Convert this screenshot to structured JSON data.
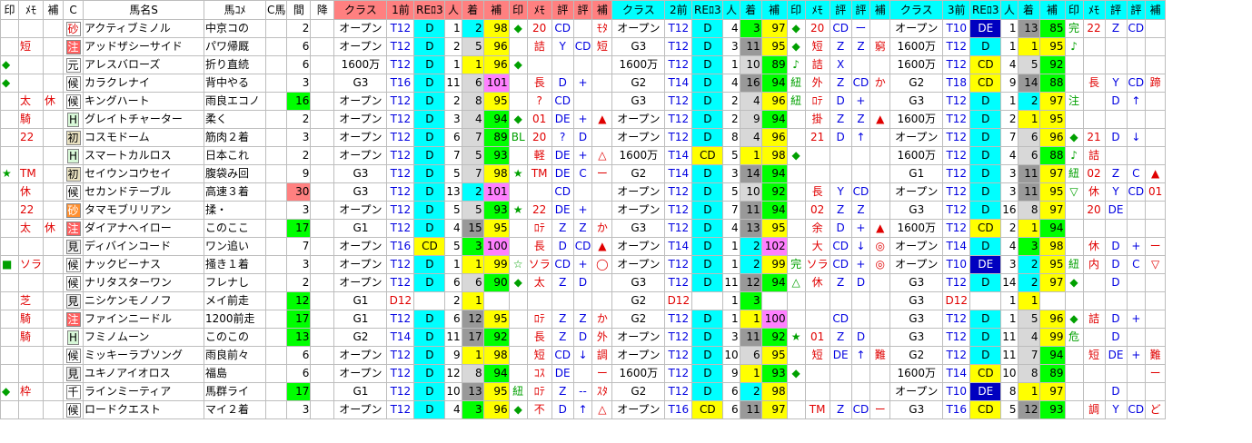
{
  "header": [
    "印",
    "ﾒﾓ",
    "補",
    "C",
    "馬名S",
    "馬ｺﾒ",
    "C馬",
    "間",
    "降",
    "クラス",
    "1前",
    "REﾛ3",
    "人",
    "着",
    "補",
    "印",
    "ﾒﾓ",
    "評",
    "評",
    "補",
    "クラス",
    "2前",
    "REﾛ3",
    "人",
    "着",
    "補",
    "印",
    "ﾒﾓ",
    "評",
    "評",
    "補",
    "クラス",
    "3前",
    "REﾛ3",
    "人",
    "着",
    "補",
    "印",
    "ﾒﾓ",
    "評",
    "評",
    "補"
  ],
  "rows": [
    [
      "",
      "",
      "",
      "砂",
      "アクティブミノル",
      "中京コの",
      "",
      "2",
      "",
      "オープン",
      "T12",
      "D",
      "1",
      "2",
      "98",
      "◆",
      "20",
      "CD",
      "",
      "ﾓﾀ",
      "オープン",
      "T12",
      "D",
      "4",
      "3",
      "97",
      "◆",
      "20",
      "CD",
      "ー",
      "",
      "オープン",
      "T10",
      "DE",
      "1",
      "13",
      "85",
      "完",
      "22",
      "Z",
      "CD",
      ""
    ],
    [
      "",
      "短",
      "",
      "注",
      "アッドザシーサイド",
      "パワ帰厩",
      "",
      "6",
      "",
      "オープン",
      "T12",
      "D",
      "2",
      "5",
      "96",
      "",
      "詰",
      "Y",
      "CD",
      "短",
      "G3",
      "T12",
      "D",
      "3",
      "11",
      "95",
      "◆",
      "短",
      "Z",
      "Z",
      "窮",
      "1600万",
      "T12",
      "D",
      "1",
      "1",
      "95",
      "♪",
      "",
      "",
      "",
      ""
    ],
    [
      "◆",
      "",
      "",
      "元",
      "アレスバローズ",
      "折り直続",
      "",
      "6",
      "",
      "1600万",
      "T12",
      "D",
      "1",
      "1",
      "96",
      "◆",
      "",
      "",
      "",
      "",
      "1600万",
      "T12",
      "D",
      "1",
      "10",
      "89",
      "♪",
      "詰",
      "X",
      "",
      "",
      "1600万",
      "T12",
      "CD",
      "4",
      "5",
      "92",
      "",
      "",
      "",
      "",
      ""
    ],
    [
      "◆",
      "",
      "",
      "候",
      "カラクレナイ",
      "背中やる",
      "",
      "3",
      "",
      "G3",
      "T16",
      "D",
      "11",
      "6",
      "101",
      "",
      "長",
      "D",
      "+",
      "",
      "G2",
      "T14",
      "D",
      "4",
      "16",
      "94",
      "紐",
      "外",
      "Z",
      "CD",
      "か",
      "G2",
      "T18",
      "CD",
      "9",
      "14",
      "88",
      "",
      "長",
      "Y",
      "CD",
      "蹄"
    ],
    [
      "",
      "太",
      "休",
      "候",
      "キングハート",
      "雨良エコノ",
      "",
      "16",
      "",
      "オープン",
      "T12",
      "D",
      "2",
      "8",
      "95",
      "",
      "?",
      "CD",
      "",
      "",
      "G3",
      "T12",
      "D",
      "2",
      "4",
      "96",
      "紐",
      "ﾛﾃ",
      "D",
      "+",
      "",
      "G3",
      "T12",
      "D",
      "1",
      "2",
      "97",
      "注",
      "",
      "D",
      "↑",
      ""
    ],
    [
      "",
      "騎",
      "",
      "H",
      "グレイトチャーター",
      "柔く",
      "",
      "2",
      "",
      "オープン",
      "T12",
      "D",
      "3",
      "4",
      "94",
      "◆",
      "01",
      "DE",
      "+",
      "▲",
      "オープン",
      "T12",
      "D",
      "2",
      "9",
      "94",
      "",
      "掛",
      "Z",
      "Z",
      "▲",
      "1600万",
      "T12",
      "D",
      "2",
      "1",
      "95",
      "",
      "",
      "",
      "",
      ""
    ],
    [
      "",
      "22",
      "",
      "初",
      "コスモドーム",
      "筋肉２着",
      "",
      "3",
      "",
      "オープン",
      "T12",
      "D",
      "6",
      "7",
      "89",
      "BL",
      "20",
      "?",
      "D",
      "",
      "オープン",
      "T12",
      "D",
      "8",
      "4",
      "96",
      "",
      "21",
      "D",
      "↑",
      "",
      "オープン",
      "T12",
      "D",
      "7",
      "6",
      "96",
      "◆",
      "21",
      "D",
      "↓",
      ""
    ],
    [
      "",
      "",
      "",
      "H",
      "スマートカルロス",
      "日本これ",
      "",
      "2",
      "",
      "オープン",
      "T12",
      "D",
      "7",
      "5",
      "93",
      "",
      "軽",
      "DE",
      "+",
      "△",
      "1600万",
      "T14",
      "CD",
      "5",
      "1",
      "98",
      "◆",
      "",
      "",
      "",
      "",
      "1600万",
      "T12",
      "D",
      "4",
      "6",
      "88",
      "♪",
      "詰",
      "",
      "",
      ""
    ],
    [
      "★",
      "TM",
      "",
      "初",
      "セイウンコウセイ",
      "腹袋み回",
      "",
      "9",
      "",
      "G3",
      "T12",
      "D",
      "5",
      "7",
      "98",
      "★",
      "TM",
      "DE",
      "C",
      "ー",
      "G2",
      "T14",
      "D",
      "3",
      "14",
      "94",
      "",
      "",
      "",
      "",
      "",
      "G1",
      "T12",
      "D",
      "3",
      "11",
      "97",
      "紐",
      "02",
      "Z",
      "C",
      "▲"
    ],
    [
      "",
      "休",
      "",
      "候",
      "セカンドテーブル",
      "高速３着",
      "",
      "30",
      "",
      "G3",
      "T12",
      "D",
      "13",
      "2",
      "101",
      "",
      "",
      "CD",
      "",
      "",
      "オープン",
      "T12",
      "D",
      "5",
      "10",
      "92",
      "",
      "長",
      "Y",
      "CD",
      "",
      "オープン",
      "T12",
      "D",
      "3",
      "11",
      "95",
      "▽",
      "休",
      "Y",
      "CD",
      "01"
    ],
    [
      "",
      "22",
      "",
      "砂",
      "タマモブリリアン",
      "揉・",
      "",
      "3",
      "",
      "オープン",
      "T12",
      "D",
      "5",
      "5",
      "93",
      "★",
      "22",
      "DE",
      "+",
      "",
      "オープン",
      "T12",
      "D",
      "7",
      "11",
      "94",
      "",
      "02",
      "Z",
      "Z",
      "",
      "G3",
      "T12",
      "D",
      "16",
      "8",
      "97",
      "",
      "20",
      "DE",
      "",
      ""
    ],
    [
      "",
      "太",
      "休",
      "注",
      "ダイアナヘイロー",
      "このここ",
      "",
      "17",
      "",
      "G1",
      "T12",
      "D",
      "4",
      "15",
      "95",
      "",
      "ﾛﾃ",
      "Z",
      "Z",
      "か",
      "G3",
      "T12",
      "D",
      "4",
      "13",
      "95",
      "",
      "余",
      "D",
      "+",
      "▲",
      "1600万",
      "T12",
      "CD",
      "2",
      "1",
      "94",
      "",
      "",
      "",
      "",
      ""
    ],
    [
      "",
      "",
      "",
      "見",
      "ディバインコード",
      "ワン追い",
      "",
      "7",
      "",
      "オープン",
      "T16",
      "CD",
      "5",
      "3",
      "100",
      "",
      "長",
      "D",
      "CD",
      "▲",
      "オープン",
      "T14",
      "D",
      "1",
      "2",
      "102",
      "",
      "大",
      "CD",
      "↓",
      "◎",
      "オープン",
      "T14",
      "D",
      "4",
      "3",
      "98",
      "",
      "休",
      "D",
      "+",
      "ー"
    ],
    [
      "■",
      "ソラ",
      "",
      "候",
      "ナックビーナス",
      "掻き１着",
      "",
      "3",
      "",
      "オープン",
      "T12",
      "D",
      "1",
      "1",
      "99",
      "☆",
      "ソラ",
      "CD",
      "+",
      "◯",
      "オープン",
      "T12",
      "D",
      "1",
      "2",
      "99",
      "完",
      "ソラ",
      "CD",
      "+",
      "◎",
      "オープン",
      "T10",
      "DE",
      "3",
      "2",
      "95",
      "紐",
      "内",
      "D",
      "C",
      "▽"
    ],
    [
      "",
      "",
      "",
      "候",
      "ナリタスターワン",
      "フレナし",
      "",
      "2",
      "",
      "オープン",
      "T12",
      "D",
      "6",
      "6",
      "90",
      "◆",
      "太",
      "Z",
      "D",
      "",
      "G3",
      "T12",
      "D",
      "11",
      "12",
      "94",
      "△",
      "休",
      "Z",
      "D",
      "",
      "G3",
      "T12",
      "D",
      "14",
      "2",
      "97",
      "◆",
      "",
      "D",
      "",
      ""
    ],
    [
      "",
      "芝",
      "",
      "見",
      "ニシケンモノノフ",
      "メイ前走",
      "",
      "12",
      "",
      "G1",
      "D12",
      "",
      "2",
      "1",
      "",
      "",
      "",
      "",
      "",
      "",
      "G2",
      "D12",
      "",
      "1",
      "3",
      "",
      "",
      "",
      "",
      "",
      "",
      "G3",
      "D12",
      "",
      "1",
      "1",
      "",
      "",
      "",
      "",
      "",
      ""
    ],
    [
      "",
      "騎",
      "",
      "注",
      "ファインニードル",
      "1200前走",
      "",
      "17",
      "",
      "G1",
      "T12",
      "D",
      "6",
      "12",
      "95",
      "",
      "ﾛﾃ",
      "Z",
      "Z",
      "か",
      "G2",
      "T12",
      "D",
      "1",
      "1",
      "100",
      "",
      "",
      "CD",
      "",
      "",
      "G3",
      "T12",
      "D",
      "1",
      "5",
      "96",
      "◆",
      "詰",
      "D",
      "+",
      ""
    ],
    [
      "",
      "騎",
      "",
      "H",
      "フミノムーン",
      "このこの",
      "",
      "13",
      "",
      "G2",
      "T14",
      "D",
      "11",
      "17",
      "92",
      "",
      "長",
      "Z",
      "D",
      "外",
      "オープン",
      "T12",
      "D",
      "3",
      "11",
      "92",
      "★",
      "01",
      "Z",
      "D",
      "",
      "G3",
      "T12",
      "D",
      "11",
      "4",
      "99",
      "危",
      "",
      "D",
      "",
      ""
    ],
    [
      "",
      "",
      "",
      "候",
      "ミッキーラブソング",
      "雨良前々",
      "",
      "6",
      "",
      "オープン",
      "T12",
      "D",
      "9",
      "1",
      "98",
      "",
      "短",
      "CD",
      "↓",
      "調",
      "オープン",
      "T12",
      "D",
      "10",
      "6",
      "95",
      "",
      "短",
      "DE",
      "↑",
      "難",
      "G2",
      "T12",
      "D",
      "11",
      "7",
      "94",
      "",
      "短",
      "DE",
      "+",
      "難"
    ],
    [
      "",
      "",
      "",
      "見",
      "ユキノアイオロス",
      "福島",
      "",
      "6",
      "",
      "オープン",
      "T12",
      "D",
      "12",
      "8",
      "94",
      "",
      "ｺｽ",
      "DE",
      "",
      "ー",
      "1600万",
      "T12",
      "D",
      "9",
      "1",
      "93",
      "◆",
      "",
      "",
      "",
      "",
      "1600万",
      "T14",
      "CD",
      "10",
      "8",
      "89",
      "",
      "",
      "",
      "",
      "ー"
    ],
    [
      "◆",
      "枠",
      "",
      "千",
      "ラインミーティア",
      "馬群ライ",
      "",
      "17",
      "",
      "G1",
      "T12",
      "D",
      "10",
      "13",
      "95",
      "紐",
      "ﾛﾃ",
      "Z",
      "--",
      "ｽﾀ",
      "G2",
      "T12",
      "D",
      "6",
      "2",
      "98",
      "",
      "",
      "",
      "",
      "",
      "オープン",
      "T10",
      "DE",
      "8",
      "1",
      "97",
      "",
      "",
      "D",
      "",
      ""
    ],
    [
      "",
      "",
      "",
      "候",
      "ロードクエスト",
      "マイ２着",
      "",
      "3",
      "",
      "オープン",
      "T12",
      "D",
      "4",
      "3",
      "96",
      "◆",
      "不",
      "D",
      "↑",
      "△",
      "オープン",
      "T16",
      "CD",
      "6",
      "11",
      "97",
      "",
      "TM",
      "Z",
      "CD",
      "ー",
      "G3",
      "T16",
      "CD",
      "5",
      "12",
      "93",
      "",
      "調",
      "Y",
      "CD",
      "ど"
    ]
  ],
  "colors": {
    "header_pink": "#ff8080",
    "header_cyan": "#00ffff",
    "yellow": "#ffff00",
    "green": "#00ff00",
    "pink": "#ff80ff",
    "navy": "#0000c0",
    "red_text": "#e00000",
    "green_text": "#00a000",
    "blue_text": "#0000e0"
  }
}
